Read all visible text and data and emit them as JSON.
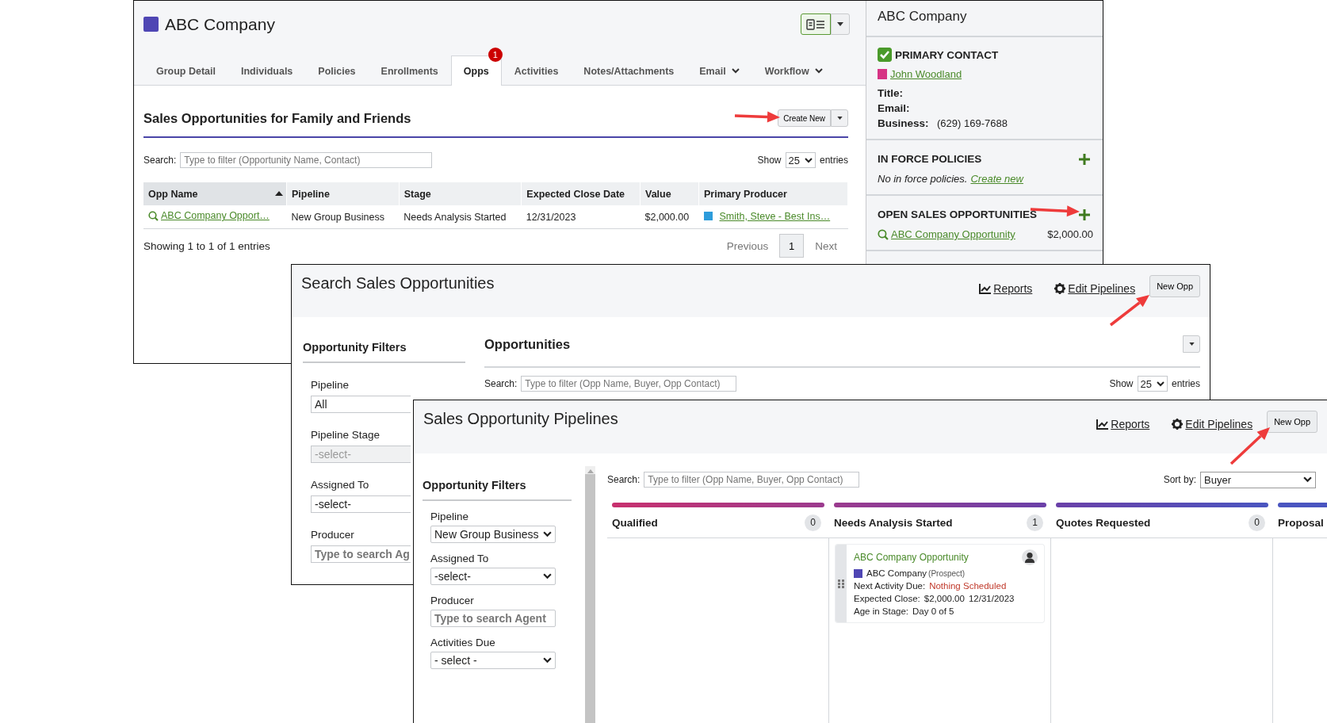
{
  "account_page": {
    "title": "ABC Company",
    "tabs": [
      {
        "label": "Group Detail",
        "selected": false,
        "has_menu": false
      },
      {
        "label": "Individuals",
        "selected": false,
        "has_menu": false
      },
      {
        "label": "Policies",
        "selected": false,
        "has_menu": false
      },
      {
        "label": "Enrollments",
        "selected": false,
        "has_menu": false
      },
      {
        "label": "Opps",
        "selected": true,
        "has_menu": false,
        "badge": "1"
      },
      {
        "label": "Activities",
        "selected": false,
        "has_menu": false
      },
      {
        "label": "Notes/Attachments",
        "selected": false,
        "has_menu": false
      },
      {
        "label": "Email",
        "selected": false,
        "has_menu": true
      },
      {
        "label": "Workflow",
        "selected": false,
        "has_menu": true
      }
    ],
    "section_title": "Sales Opportunities for Family and Friends",
    "create_button": "Create New",
    "search": {
      "label": "Search:",
      "placeholder": "Type to filter (Opportunity Name, Contact)"
    },
    "show": {
      "label": "Show",
      "value": "25",
      "suffix": "entries"
    },
    "columns": [
      {
        "label": "Opp Name",
        "sorted": true
      },
      {
        "label": "Pipeline",
        "sorted": false
      },
      {
        "label": "Stage",
        "sorted": false
      },
      {
        "label": "Expected Close Date",
        "sorted": false
      },
      {
        "label": "Value",
        "sorted": false
      },
      {
        "label": "Primary Producer",
        "sorted": false
      }
    ],
    "rows": [
      {
        "name": "ABC Company Opport…",
        "pipeline": "New Group Business",
        "stage": "Needs Analysis Started",
        "close_date": "12/31/2023",
        "value": "$2,000.00",
        "producer": "Smith, Steve - Best Ins…"
      }
    ],
    "footer": "Showing 1 to 1 of 1 entries",
    "pagination": {
      "previous": "Previous",
      "page": "1",
      "next": "Next"
    },
    "sidebar": {
      "title": "ABC Company",
      "contact": {
        "heading": "PRIMARY CONTACT",
        "checked": true,
        "name": "John Woodland",
        "color": "#d63384",
        "fields": [
          {
            "label": "Title:"
          },
          {
            "label": "Email:"
          },
          {
            "label": "Business:",
            "value": "(629) 169-7688"
          }
        ]
      },
      "policies": {
        "heading": "IN FORCE POLICIES",
        "empty_text": "No in force policies.",
        "link": "Create new"
      },
      "opportunities": {
        "heading": "OPEN SALES OPPORTUNITIES",
        "items": [
          {
            "name": "ABC Company Opportunity",
            "value": "$2,000.00"
          }
        ]
      }
    }
  },
  "search_page": {
    "title": "Search Sales Opportunities",
    "reports_link": "Reports",
    "pipelines_link": "Edit Pipelines",
    "new_button": "New Opp",
    "filters_title": "Opportunity Filters",
    "filters": [
      {
        "label": "Pipeline",
        "kind": "select",
        "value": "All",
        "disabled": false
      },
      {
        "label": "Pipeline Stage",
        "kind": "select",
        "value": "-select-",
        "disabled": true
      },
      {
        "label": "Assigned To",
        "kind": "select",
        "value": "-select-",
        "disabled": false
      },
      {
        "label": "Producer",
        "kind": "input",
        "placeholder": "Type to search Ag",
        "disabled": false
      }
    ],
    "list_title": "Opportunities",
    "search": {
      "label": "Search:",
      "placeholder": "Type to filter (Opp Name, Buyer, Opp Contact)"
    },
    "show": {
      "label": "Show",
      "value": "25",
      "suffix": "entries"
    }
  },
  "pipelines_page": {
    "title": "Sales Opportunity Pipelines",
    "reports_link": "Reports",
    "pipelines_link": "Edit Pipelines",
    "new_button": "New Opp",
    "filters_title": "Opportunity Filters",
    "filters": [
      {
        "label": "Pipeline",
        "kind": "select",
        "value": "New Group Business"
      },
      {
        "label": "Assigned To",
        "kind": "select",
        "value": "-select-"
      },
      {
        "label": "Producer",
        "kind": "input",
        "placeholder": "Type to search Agent"
      },
      {
        "label": "Activities Due",
        "kind": "select",
        "value": "- select -"
      }
    ],
    "search": {
      "label": "Search:",
      "placeholder": "Type to filter (Opp Name, Buyer, Opp Contact)"
    },
    "sort": {
      "label": "Sort by:",
      "value": "Buyer"
    },
    "stages": [
      {
        "name": "Qualified",
        "count": "0",
        "color": "#c8306e"
      },
      {
        "name": "Needs Analysis Started",
        "count": "1",
        "color": "#9b3a8e",
        "cards": [
          {
            "title": "ABC Company Opportunity",
            "company": "ABC Company",
            "status": "(Prospect)",
            "fields": [
              {
                "label": "Next Activity Due:",
                "kind": "alert",
                "values": [
                  "Nothing Scheduled"
                ]
              },
              {
                "label": "Expected Close:",
                "kind": "plain",
                "values": [
                  "$2,000.00",
                  "12/31/2023"
                ]
              },
              {
                "label": "Age in Stage:",
                "kind": "plain",
                "values": [
                  "Day 0 of 5"
                ]
              }
            ]
          }
        ]
      },
      {
        "name": "Quotes Requested",
        "count": "0",
        "color": "#6a40a8"
      },
      {
        "name": "Proposal",
        "color": "#4a55c0"
      }
    ]
  }
}
